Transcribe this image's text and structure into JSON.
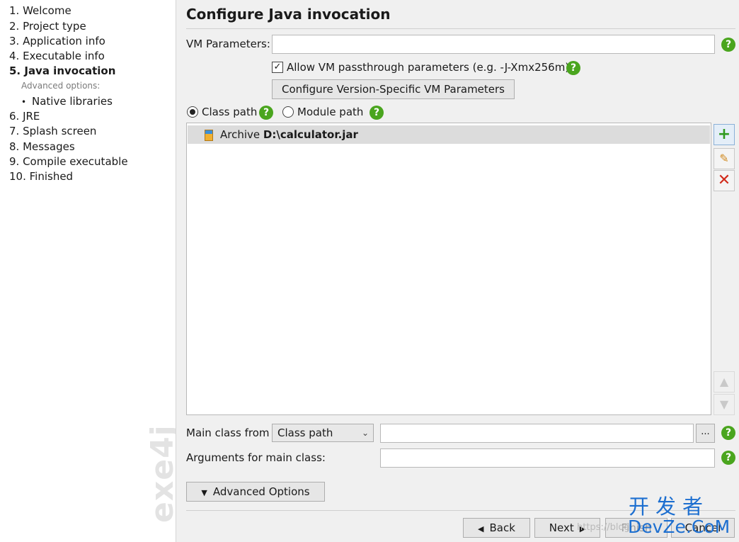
{
  "sidebar": {
    "steps": [
      {
        "label": "1. Welcome"
      },
      {
        "label": "2. Project type"
      },
      {
        "label": "3. Application info"
      },
      {
        "label": "4. Executable info"
      },
      {
        "label": "5. Java invocation",
        "active": true
      },
      {
        "label": "6. JRE"
      },
      {
        "label": "7. Splash screen"
      },
      {
        "label": "8. Messages"
      },
      {
        "label": "9. Compile executable"
      },
      {
        "label": "10. Finished"
      }
    ],
    "advanced_options_label": "Advanced options:",
    "sub_step": "Native libraries",
    "watermark": "exe4j"
  },
  "page": {
    "title": "Configure Java invocation"
  },
  "vm_parameters": {
    "label": "VM Parameters:",
    "value": ""
  },
  "passthrough": {
    "checked": true,
    "label": "Allow VM passthrough parameters (e.g. -J-Xmx256m)"
  },
  "configure_vm_button": "Configure Version-Specific VM Parameters",
  "path_mode": {
    "class_path_label": "Class path",
    "module_path_label": "Module path",
    "selected": "Class path"
  },
  "classpath_list": [
    {
      "prefix": "Archive",
      "path": "D:\\calculator.jar"
    }
  ],
  "main_class": {
    "label": "Main class from",
    "select_value": "Class path",
    "value": "",
    "browse_label": "..."
  },
  "arguments": {
    "label": "Arguments for main class:",
    "value": ""
  },
  "advanced_button": "Advanced Options",
  "nav": {
    "back": "Back",
    "next": "Next",
    "finish": "Finish",
    "cancel": "Cancel"
  },
  "overlay": {
    "brand_cn": "开发者",
    "brand_en": "DevZe.CoM",
    "blog_watermark": "https://blog"
  },
  "colors": {
    "help_green": "#4aa51e",
    "brand_blue": "#1d6fd0",
    "delete_red": "#d12a1a",
    "add_green": "#2f9a1e"
  },
  "icons": {
    "help": "question-circle",
    "add": "plus",
    "edit": "pencil",
    "delete": "x-mark",
    "move_up": "chevron-up",
    "move_down": "chevron-down",
    "archive": "jar-file"
  }
}
